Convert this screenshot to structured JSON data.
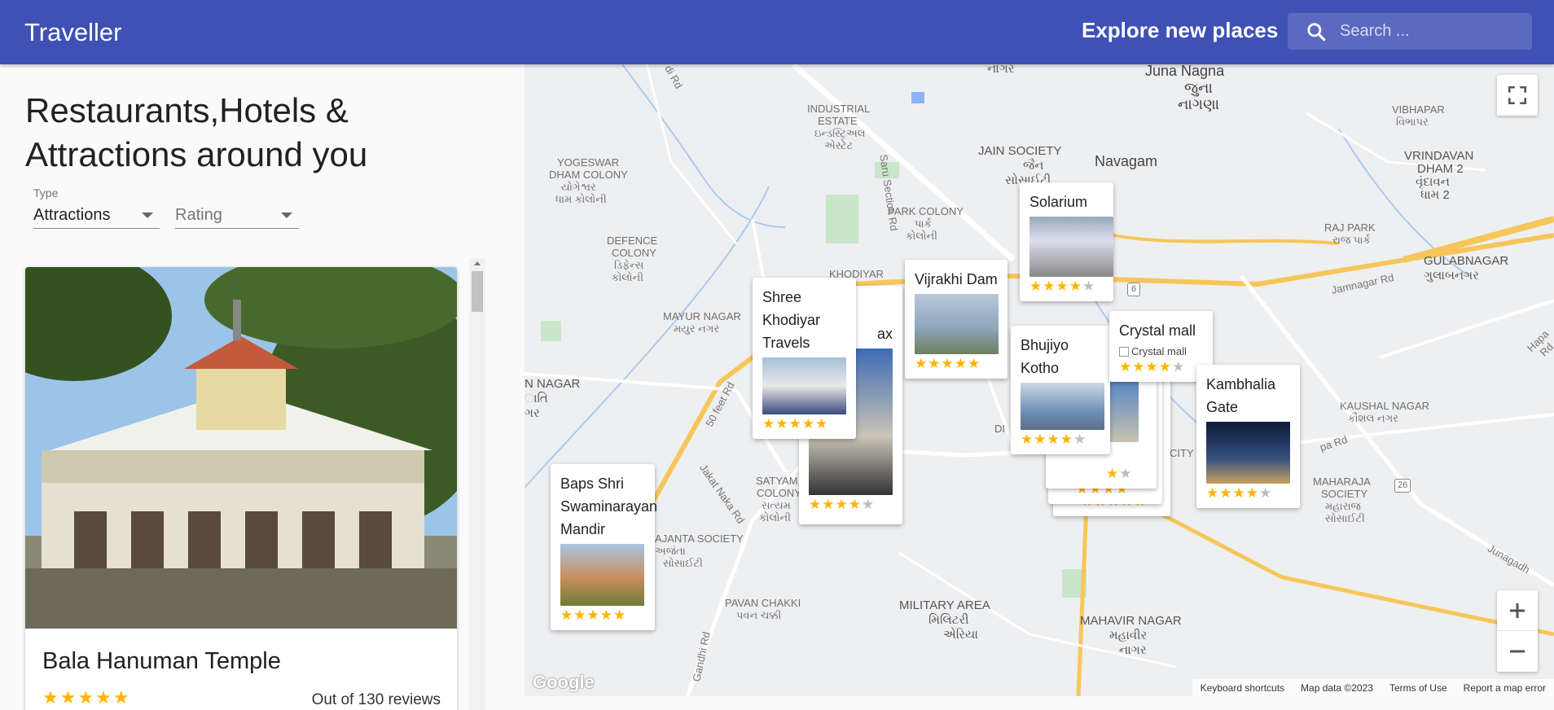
{
  "app": {
    "title": "Traveller",
    "explore": "Explore new places",
    "search_placeholder": "Search ..."
  },
  "panel": {
    "heading": "Restaurants,Hotels & Attractions around you",
    "type_label": "Type",
    "type_value": "Attractions",
    "rating_placeholder": "Rating"
  },
  "card": {
    "title": "Bala Hanuman Temple",
    "stars": "★★★★★",
    "reviews": "Out of 130 reviews"
  },
  "map": {
    "labels": [
      "Juna Nagna",
      "જુના",
      "નાગણા",
      "નાગર",
      "INDUSTRIAL",
      "ESTATE",
      "ઇન્ડસ્ટ્રિઅલ",
      "એસ્ટેટ",
      "JAIN SOCIETY",
      "જૈન",
      "સોસાઈટી",
      "Navagam",
      "VIBHAPAR",
      "વિભાપર",
      "VRINDAVAN",
      "DHAM 2",
      "વૃંદાવન",
      "ધામ 2",
      "YOGESWAR",
      "DHAM COLONY",
      "યોગેશ્વર",
      "ધામ કોલોની",
      "PARK COLONY",
      "પાર્ક",
      "કોલોની",
      "RAJ PARK",
      "રાજ પાર્ક",
      "DEFENCE",
      "COLONY",
      "ડિફેન્સ",
      "કોલોની",
      "GULABNAGAR",
      "ગુલાબનગર",
      "KHODIYAR",
      "MAYUR NAGAR",
      "મયુર નગર",
      "N NAGAR",
      "ાતિ",
      "ગર",
      "KAUSHAL NAGAR",
      "કૌશલ નગર",
      "SATYAM",
      "COLONY",
      "સત્યમ",
      "કોલોની",
      "DI",
      "CITY",
      "MAHARAJA",
      "SOCIETY",
      "મહારાજ",
      "સોસાઈટી",
      "AJANTA SOCIETY",
      "અજંતા",
      "સોસાઈટી",
      "PAVAN CHAKKI",
      "પવન ચક્કી",
      "MILITARY AREA",
      "મિલિટરી",
      "એરિયા",
      "MAHAVIR NAGAR",
      "મહાવીર",
      "નાગર",
      "Saru Section Rd",
      "50 feet Rd",
      "Jakat Naka Rd",
      "Jamnagar Rd",
      "Hapa Rd",
      "pa Rd",
      "Junagadh",
      "Gandhi Rd",
      "di Rd",
      "6",
      "26"
    ],
    "google": "Google",
    "attribution": [
      "Keyboard shortcuts",
      "Map data ©2023",
      "Terms of Use",
      "Report a map error"
    ],
    "pins": [
      {
        "title": "Solarium",
        "stars": "★★★★",
        "off": "★"
      },
      {
        "title": "Vijrakhi Dam",
        "stars": "★★★★★",
        "off": ""
      },
      {
        "title": "Shree Khodiyar Travels",
        "stars": "★★★★★",
        "off": ""
      },
      {
        "title": "ax",
        "stars": "★★★★",
        "off": "★"
      },
      {
        "title": "Bhujiyo Kotho",
        "stars": "★★★★",
        "off": "★"
      },
      {
        "title": "Crystal mall",
        "alt": "Crystal mall",
        "stars": "★★★★",
        "off": "★"
      },
      {
        "title": "Kambhalia Gate",
        "stars": "★★★★",
        "off": "★"
      },
      {
        "title": "Baps Shri Swaminarayan Mandir",
        "stars": "★★★★★",
        "off": ""
      },
      {
        "title": "",
        "stars": "★",
        "off": "★"
      },
      {
        "title": "",
        "stars": "★★★★",
        "off": ""
      },
      {
        "title": "",
        "stars": "★★★★★",
        "off": ""
      }
    ]
  },
  "colors": {
    "primary": "#3f51b5",
    "star": "#ffb400",
    "road_major": "#f7c65a"
  },
  "icons": [
    "search-icon",
    "fullscreen-icon",
    "zoom-in-icon",
    "zoom-out-icon"
  ]
}
